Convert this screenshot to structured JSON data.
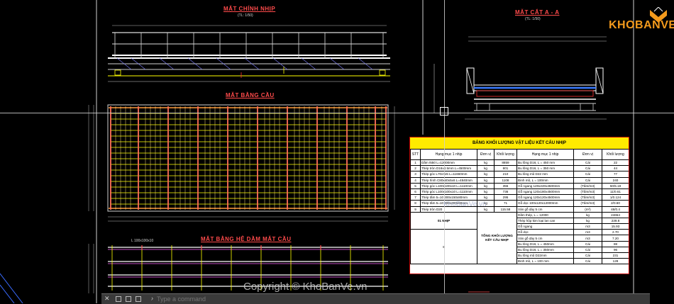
{
  "drawing": {
    "view_elevation": {
      "title": "MẶT CHÍNH NHỊP",
      "scale": "(TL: 1/50)"
    },
    "view_section": {
      "title": "MẶT CẮT A - A",
      "scale": "(TL: 1/50)"
    },
    "view_deck_plan": {
      "title": "MẶT BẰNG CẦU"
    },
    "view_beam_plan": {
      "title": "MẶT BẰNG HỆ DẦM MẶT CẦU"
    },
    "beam_plan_label": "L 100x100x10"
  },
  "logo": {
    "text": "KHOBANVE"
  },
  "bom": {
    "title": "BẢNG KHỐI LƯỢNG VẬT LIỆU KẾT CẤU NHỊP",
    "headers": [
      "STT",
      "Hạng mục 1 nhịp",
      "Đơn vị",
      "Khối lượng",
      "Hạng mục 1 nhịp",
      "Đơn vị",
      "Khối lượng"
    ],
    "rows": [
      [
        "1",
        "Dầm I550 L=12000mm",
        "kg",
        "8859",
        "Bu lông D16, L = 450 mm",
        "Cái",
        "22"
      ],
      [
        "2",
        "Thép tròn D16x4.5mm L=4500mm",
        "kg",
        "801",
        "Bu lông D16, L = 350 mm",
        "Cái",
        "44"
      ],
      [
        "3",
        "Thép góc L70x7x5 L=11660mm",
        "kg",
        "210",
        "Bu lông mũ D22 mm",
        "Cái",
        "77"
      ],
      [
        "4",
        "Thép hình C80x40x5x6 L=4840mm",
        "kg",
        "1108",
        "Đinh mũ, L = 100mm",
        "Cái",
        "240"
      ],
      [
        "5",
        "Thép góc L100x100x10 L=1110mm",
        "kg",
        "355",
        "Gỗ ngang 120x220x4500mm",
        "(Tấm/m3)",
        "50/5.18"
      ],
      [
        "6",
        "Thép góc L100x100x10 L=1110mm",
        "kg",
        "736",
        "Gỗ ngang 120x180x4500mm",
        "(Tấm/m3)",
        "11/0.61"
      ],
      [
        "7",
        "Thép tấm 5=10 300x150x80mm",
        "kg",
        "295",
        "Gỗ ngang 120x120x4500mm",
        "(Tấm/m3)",
        "1/0.124"
      ],
      [
        "8",
        "Thép tấm 5=10 300x300x80mm",
        "kg",
        "71",
        "Gỗ dọc 100x120x12000mm",
        "(Tấm/m3)",
        "2/0.60"
      ],
      [
        "9",
        "Thép tròn D20",
        "kg",
        "115.58",
        "Ván gỗ dày 5 cm",
        "(m²)",
        "48/0.4"
      ]
    ],
    "summary_label": "01 NHỊP",
    "summary_stt": "8",
    "summary_group": "TỔNG KHỐI LƯỢNG KẾT CẤU NHỊP",
    "summary_rows": [
      [
        "Dầm thép, L = 12000",
        "kg",
        "24654"
      ],
      [
        "Thép hộp kim loại lan can",
        "kg",
        "239.8"
      ],
      [
        "Gỗ ngang",
        "m3",
        "15.93"
      ],
      [
        "Gỗ dọc",
        "m3",
        "2.70"
      ],
      [
        "Ván gỗ dày 5 cm",
        "m3",
        "7.20"
      ],
      [
        "Bu lông D16, L = 450mm",
        "Cái",
        "88"
      ],
      [
        "Bu lông D16, L = 350mm",
        "Cái",
        "96"
      ],
      [
        "Bu lông mũ D22mm",
        "Cái",
        "231"
      ],
      [
        "Đinh mũ, L = 100 mm",
        "Cái",
        "128"
      ]
    ]
  },
  "watermark": {
    "main": "Copyright © KhoBanVe.vn",
    "secondary": "KhoBanVe.vn"
  },
  "command": {
    "close_glyph": "✕",
    "prompt": "›",
    "placeholder": "Type a command"
  }
}
